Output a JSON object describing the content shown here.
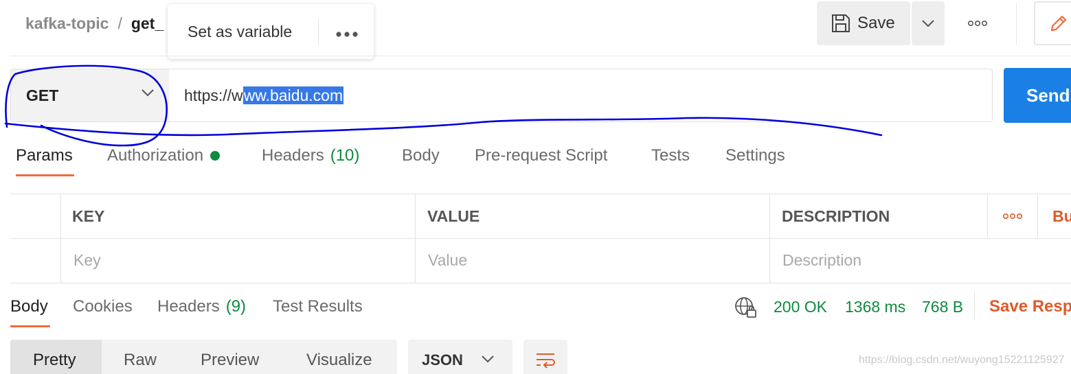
{
  "header": {
    "breadcrumb_parent": "kafka-topic",
    "breadcrumb_sep": "/",
    "breadcrumb_current": "get_",
    "save_label": "Save"
  },
  "popup": {
    "label": "Set as variable",
    "more": "•••"
  },
  "request": {
    "method": "GET",
    "url_prefix": "https://w",
    "url_selected": "ww.baidu.com",
    "send_label": "Send"
  },
  "request_tabs": [
    {
      "label": "Params",
      "active": true
    },
    {
      "label": "Authorization",
      "status_dot": true
    },
    {
      "label": "Headers",
      "count": "(10)"
    },
    {
      "label": "Body"
    },
    {
      "label": "Pre-request Script"
    },
    {
      "label": "Tests"
    },
    {
      "label": "Settings"
    }
  ],
  "params_table": {
    "columns": [
      "KEY",
      "VALUE",
      "DESCRIPTION"
    ],
    "placeholders": [
      "Key",
      "Value",
      "Description"
    ],
    "bulk_edit": "Bu"
  },
  "response_tabs": [
    {
      "label": "Body",
      "active": true
    },
    {
      "label": "Cookies"
    },
    {
      "label": "Headers",
      "count": "(9)"
    },
    {
      "label": "Test Results"
    }
  ],
  "response_status": {
    "status": "200 OK",
    "time": "1368 ms",
    "size": "768 B",
    "save_response": "Save Resp"
  },
  "body_modes": [
    "Pretty",
    "Raw",
    "Preview",
    "Visualize"
  ],
  "body_format": "JSON",
  "watermark": "https://blog.csdn.net/wuyong15221125927",
  "colors": {
    "accent_orange": "#f26b3a",
    "send_blue": "#1a80e6",
    "status_green": "#0f8a3e",
    "annotation_blue": "#0000dd"
  },
  "icons": [
    "save-icon",
    "chevron-down-icon",
    "more-icon",
    "edit-pencil-icon",
    "globe-lock-icon",
    "wrap-lines-icon"
  ]
}
